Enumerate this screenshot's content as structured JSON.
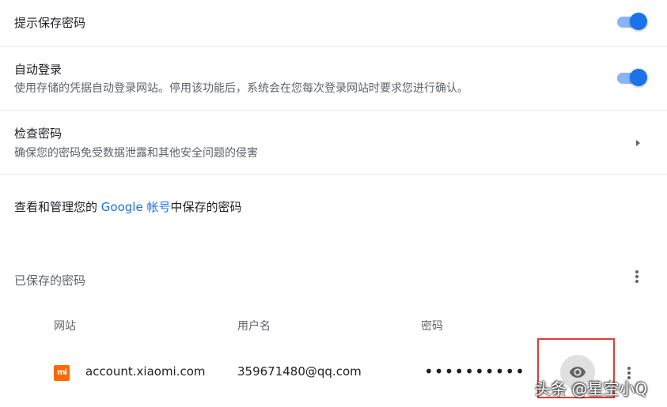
{
  "settings": {
    "offer_to_save": {
      "title": "提示保存密码",
      "enabled": true
    },
    "auto_signin": {
      "title": "自动登录",
      "description": "使用存储的凭据自动登录网站。停用该功能后，系统会在您每次登录网站时要求您进行确认。",
      "enabled": true
    },
    "check_passwords": {
      "title": "检查密码",
      "description": "确保您的密码免受数据泄露和其他安全问题的侵害"
    }
  },
  "manage": {
    "prefix": "查看和管理您的 ",
    "link_text": "Google 帐号",
    "suffix": "中保存的密码"
  },
  "saved": {
    "heading": "已保存的密码",
    "columns": {
      "site": "网站",
      "username": "用户名",
      "password": "密码"
    },
    "rows": [
      {
        "site": "account.xiaomi.com",
        "username": "359671480@qq.com",
        "password": "••••••••••",
        "logo_text": "mi"
      }
    ]
  },
  "watermark": "头条 @星空小Q",
  "colors": {
    "accent": "#1a73e8",
    "toggle_track": "#8ab4f8",
    "highlight_box": "#e53935",
    "xiaomi_orange": "#ff6900"
  }
}
